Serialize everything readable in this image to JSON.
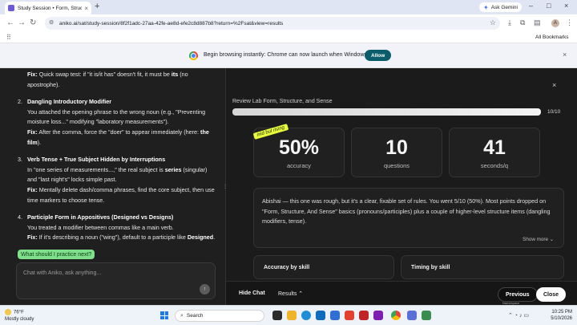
{
  "browser": {
    "tab_title": "Study Session • Form, Structure...",
    "tab_close": "×",
    "new_tab": "+",
    "gemini_label": "Ask Gemini",
    "url": "aniko.ai/sat/study-session/8f2f1adc-27aa-42fe-ae8d-efe2c8d887b8?return=%2Fsat&view=results",
    "bookmarks_label": "All Bookmarks",
    "avatar_letter": "A",
    "win_min": "–",
    "win_max": "□",
    "win_close": "×"
  },
  "infobar": {
    "message": "Begin browsing instantly: Chrome can now launch when Windows starts.",
    "allow_label": "Allow",
    "close": "×"
  },
  "chat": {
    "tip_prefix": "Fix:",
    "tip_text": " Quick swap test: if \"it is/it has\" doesn't fit, it must be ",
    "tip_bold": "its",
    "tip_suffix": " (no apostrophe).",
    "items": [
      {
        "num": "2.",
        "heading": "Dangling Introductory Modifier",
        "body": "You attached the opening phrase to the wrong noun (e.g., \"Preventing moisture loss...\" modifying \"laboratory measurements\").",
        "fix_label": "Fix:",
        "fix_text": " After the comma, force the \"doer\" to appear immediately (here: ",
        "fix_bold": "the film",
        "fix_end": ")."
      },
      {
        "num": "3.",
        "heading": "Verb Tense + True Subject Hidden by Interruptions",
        "body_pre": "In \"one series of measurements...,\" the real subject is ",
        "body_bold": "series",
        "body_post": " (singular) and \"last night's\" locks simple past.",
        "fix_label": "Fix:",
        "fix_text": " Mentally delete dash/comma phrases, find the core subject, then use time markers to choose tense."
      },
      {
        "num": "4.",
        "heading": "Participle Form in Appositives (Designed vs Designs)",
        "body": "You treated a modifier between commas like a main verb.",
        "fix_label": "Fix:",
        "fix_text": " If it's describing a noun (\"wing\"), default to a participle like ",
        "fix_bold": "Designed",
        "fix_end": "."
      }
    ],
    "suggestion": "What should I practice next?",
    "input_placeholder": "Chat with Aniko, ask anything...",
    "send_icon": "↑"
  },
  "results": {
    "close": "×",
    "review_title": "Review Lab Form, Structure, and Sense",
    "progress_fraction": 1.0,
    "progress_label": "10/10",
    "sticker": "mid but rising",
    "stats": [
      {
        "value": "50%",
        "label": "accuracy"
      },
      {
        "value": "10",
        "label": "questions"
      },
      {
        "value": "41",
        "label": "seconds/q"
      }
    ],
    "summary": "Abishai — this one was rough, but it's a clear, fixable set of rules. You went 5/10 (50%). Most points dropped on \"Form, Structure, And Sense\" basics (pronouns/participles) plus a couple of higher-level structure items (dangling modifiers, tense).",
    "show_more": "Show more ⌄",
    "accuracy_by_skill": "Accuracy by skill",
    "timing_by_skill": "Timing by skill",
    "hide_chat": "Hide Chat",
    "results_tab": "Results ⌃",
    "previous": "Previous",
    "close_button": "Close",
    "namespace": "Namespace"
  },
  "taskbar": {
    "temp": "76°F",
    "weather": "Mostly cloudy",
    "search": "Search",
    "time": "10:25 PM",
    "date": "5/10/2026"
  },
  "colors": {
    "accent_green": "#7ee08a",
    "allow_teal": "#0b5d6b",
    "sticker_yellow": "#e8ff3a"
  }
}
